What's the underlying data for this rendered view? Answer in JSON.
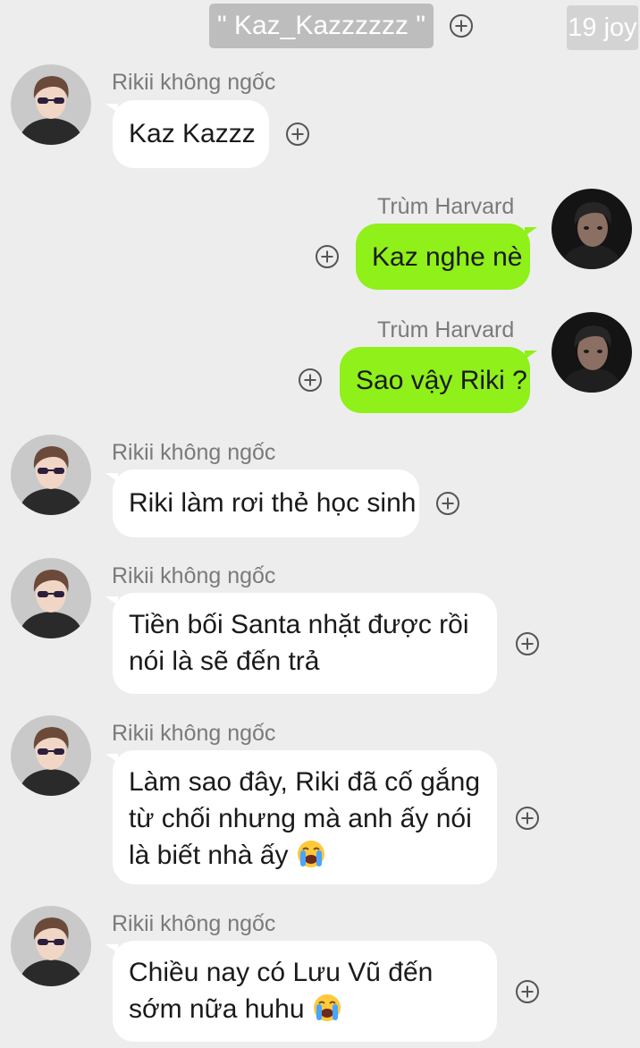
{
  "header": {
    "title": "\" Kaz_Kazzzzzz \"",
    "badge": "19 joy"
  },
  "colors": {
    "background": "#ededed",
    "incoming_bubble": "#ffffff",
    "outgoing_bubble": "#8ff01a"
  },
  "icons": {
    "add": "circle-plus-icon",
    "crying": "loudly-crying-face-emoji"
  },
  "messages": [
    {
      "sender": "Rikii không ngốc",
      "direction": "incoming",
      "lines": [
        "Kaz Kazzz"
      ]
    },
    {
      "sender": "Trùm Harvard",
      "direction": "outgoing",
      "lines": [
        "Kaz nghe nè"
      ]
    },
    {
      "sender": "Trùm Harvard",
      "direction": "outgoing",
      "lines": [
        "Sao vậy Riki ?"
      ]
    },
    {
      "sender": "Rikii không ngốc",
      "direction": "incoming",
      "lines": [
        "Riki làm rơi thẻ học sinh"
      ]
    },
    {
      "sender": "Rikii không ngốc",
      "direction": "incoming",
      "lines": [
        "Tiền bối Santa nhặt được rồi",
        "nói là sẽ đến trả"
      ]
    },
    {
      "sender": "Rikii không ngốc",
      "direction": "incoming",
      "lines": [
        "Làm sao đây, Riki đã cố gắng",
        "từ chối nhưng mà anh ấy nói",
        "là biết nhà ấy"
      ]
    },
    {
      "sender": "Rikii không ngốc",
      "direction": "incoming",
      "lines": [
        "Chiều nay có Lưu Vũ đến",
        "sớm nữa huhu"
      ]
    }
  ]
}
